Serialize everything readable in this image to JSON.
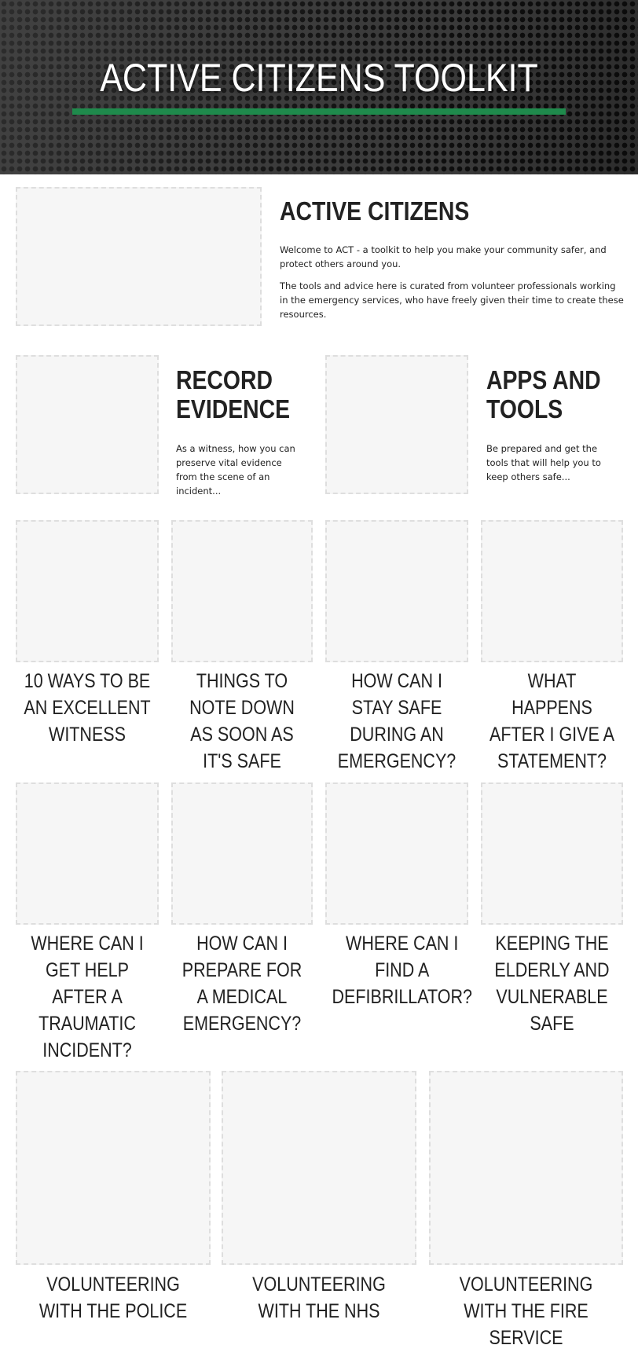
{
  "hero": {
    "title": "ACTIVE CITIZENS TOOLKIT",
    "accent_color": "#1f8a4c"
  },
  "intro": {
    "title": "ACTIVE CITIZENS",
    "paragraph_1": "Welcome to ACT - a toolkit to help you make your community safer, and protect others around you.",
    "paragraph_2": "The tools and advice here is curated from volunteer professionals working in the emergency services, who have freely given their time to create these resources."
  },
  "features": [
    {
      "title_line_1": "RECORD",
      "title_line_2": "EVIDENCE",
      "text": "As a witness, how you can preserve vital evidence from the scene of an incident..."
    },
    {
      "title_line_1": "APPS AND",
      "title_line_2": "TOOLS",
      "text": "Be prepared and get the tools that will help you to keep others safe..."
    }
  ],
  "cards_row_1": [
    {
      "title": "10 WAYS TO BE AN EXCELLENT WITNESS"
    },
    {
      "title": "THINGS TO NOTE DOWN AS SOON AS IT'S SAFE"
    },
    {
      "title": "HOW CAN I STAY SAFE DURING AN EMERGENCY?"
    },
    {
      "title": "WHAT HAPPENS AFTER I GIVE A STATEMENT?"
    }
  ],
  "cards_row_2": [
    {
      "title": "WHERE CAN I GET HELP AFTER A TRAUMATIC INCIDENT?"
    },
    {
      "title": "HOW CAN I PREPARE FOR A MEDICAL EMERGENCY?"
    },
    {
      "title": "WHERE CAN I FIND A DEFIBRILLATOR?"
    },
    {
      "title": "KEEPING THE ELDERLY AND VULNERABLE SAFE"
    }
  ],
  "cards_row_3": [
    {
      "title": "VOLUNTEERING WITH THE POLICE"
    },
    {
      "title": "VOLUNTEERING WITH THE NHS"
    },
    {
      "title": "VOLUNTEERING WITH THE FIRE SERVICE"
    }
  ]
}
